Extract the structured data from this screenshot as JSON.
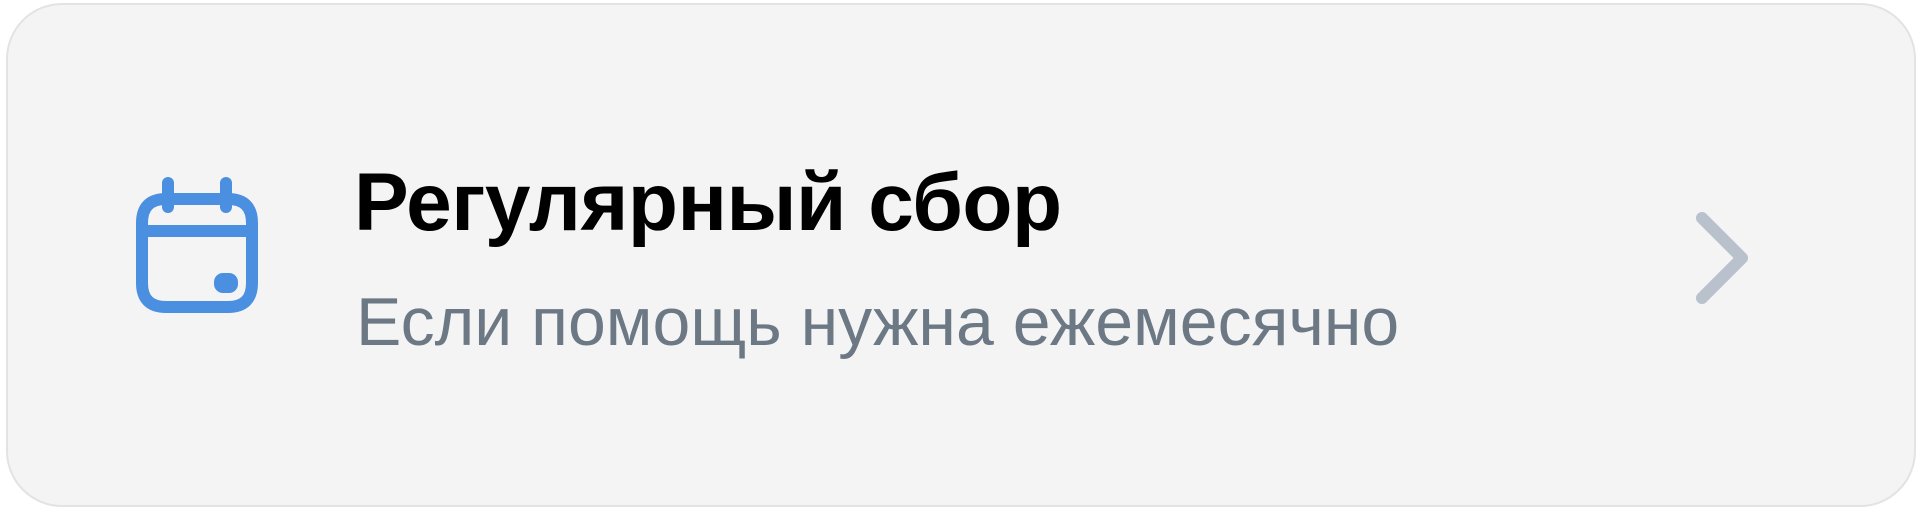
{
  "card": {
    "title": "Регулярный сбор",
    "subtitle": "Если помощь нужна ежемесячно",
    "icon": "calendar-icon",
    "trailing_icon": "chevron-right-icon"
  },
  "colors": {
    "background": "#f4f4f5",
    "border": "#e3e3e6",
    "title": "#000000",
    "subtitle": "#6d7885",
    "icon_accent": "#4a8fe0",
    "chevron": "#b8c1cc"
  }
}
